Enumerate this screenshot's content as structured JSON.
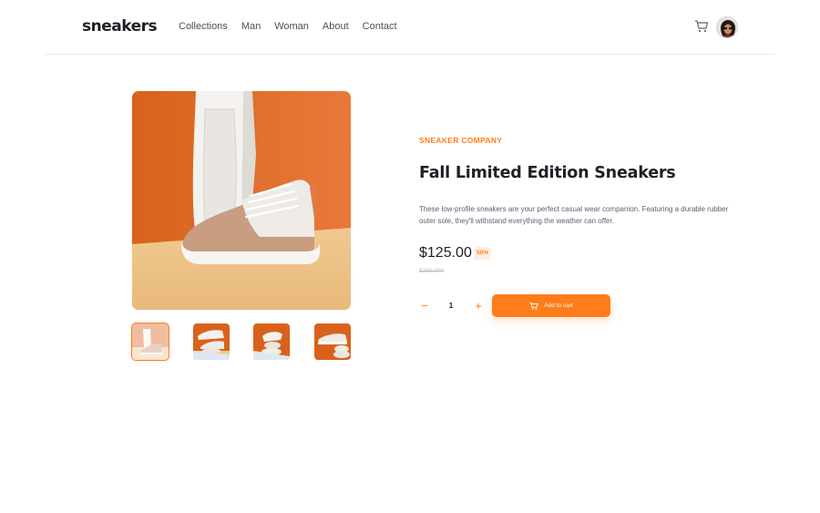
{
  "header": {
    "logo": "sneakers",
    "nav": [
      "Collections",
      "Man",
      "Woman",
      "About",
      "Contact"
    ],
    "cart_icon": "cart-icon",
    "avatar_icon": "user-avatar"
  },
  "gallery": {
    "thumbnails_count": 4,
    "active_index": 0
  },
  "product": {
    "company": "SNEAKER COMPANY",
    "title": "Fall Limited Edition Sneakers",
    "description": "These low-profile sneakers are your perfect casual wear companion. Featuring a durable rubber outer sole, they'll withstand everything the weather can offer.",
    "price": "$125.00",
    "discount": "50%",
    "old_price": "$250.000",
    "quantity": "1",
    "minus_label": "−",
    "plus_label": "+",
    "add_to_cart": "Add to cart"
  },
  "colors": {
    "accent": "#ff7d1a",
    "accent_light": "#ffede0",
    "text_dark": "#1d2026",
    "text_muted": "#5c6270"
  }
}
